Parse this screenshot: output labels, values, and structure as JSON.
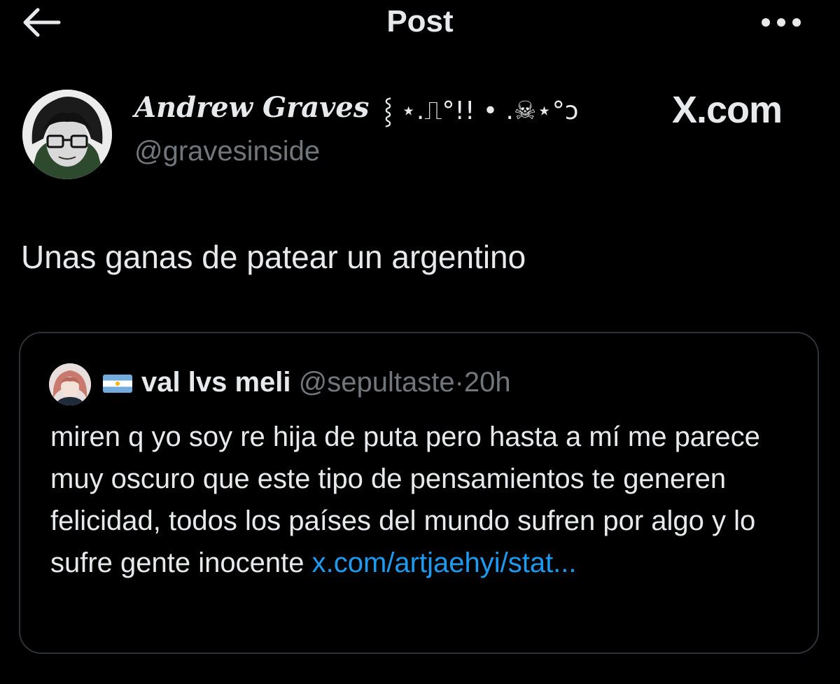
{
  "header": {
    "title": "Post",
    "back_icon": "arrow-left-icon",
    "more_icon": "more-horizontal-icon"
  },
  "post": {
    "author_name": "Andrew Graves",
    "author_name_decoration": "⸾ ⋆.⎍°!! • .☠⋆°ↄ",
    "author_handle": "@gravesinside",
    "source_label": "X.com",
    "text": "Unas ganas de patear un argentino"
  },
  "quote": {
    "flag_icon": "argentina-flag-icon",
    "author_name": "val lvs meli",
    "author_handle": "@sepultaste",
    "separator": "·",
    "time": "20h",
    "text": "miren q yo soy re hija de puta pero hasta a mí me parece muy oscuro que este tipo de pensamientos te generen felicidad, todos los países del mundo sufren por algo y lo sufre gente inocente",
    "link_text": "x.com/artjaehyi/stat..."
  },
  "colors": {
    "background": "#000000",
    "text_primary": "#e7e9ea",
    "text_secondary": "#71767b",
    "link": "#1d9bf0",
    "border": "#2f3336"
  }
}
